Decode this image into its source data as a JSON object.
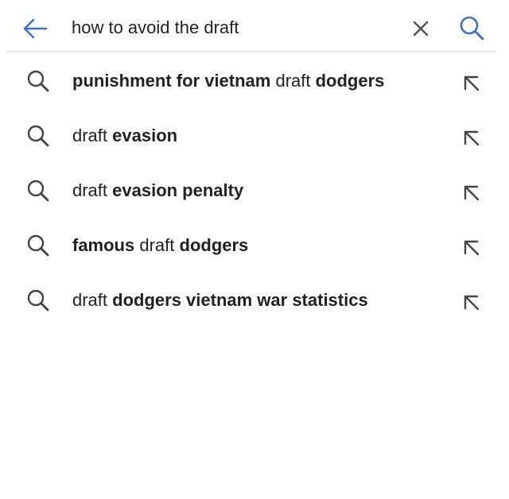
{
  "search": {
    "query": "how to avoid the draft"
  },
  "colors": {
    "accent": "#3c6fd0",
    "icon_gray": "#444444",
    "text": "#222222",
    "divider": "#e3e3e3"
  },
  "icons": {
    "back": "arrow-left-icon",
    "clear": "close-icon",
    "search": "search-icon",
    "suggestion": "search-icon",
    "fill": "arrow-up-left-icon"
  },
  "suggestions": [
    {
      "segments": [
        {
          "text": "punishment for vietnam",
          "bold": true
        },
        {
          "text": " draft ",
          "bold": false
        },
        {
          "text": "dodgers",
          "bold": true
        }
      ]
    },
    {
      "segments": [
        {
          "text": "draft ",
          "bold": false
        },
        {
          "text": "evasion",
          "bold": true
        }
      ]
    },
    {
      "segments": [
        {
          "text": "draft ",
          "bold": false
        },
        {
          "text": "evasion penalty",
          "bold": true
        }
      ]
    },
    {
      "segments": [
        {
          "text": "famous",
          "bold": true
        },
        {
          "text": " draft ",
          "bold": false
        },
        {
          "text": "dodgers",
          "bold": true
        }
      ]
    },
    {
      "segments": [
        {
          "text": "draft ",
          "bold": false
        },
        {
          "text": "dodgers vietnam war statistics",
          "bold": true
        }
      ]
    }
  ]
}
